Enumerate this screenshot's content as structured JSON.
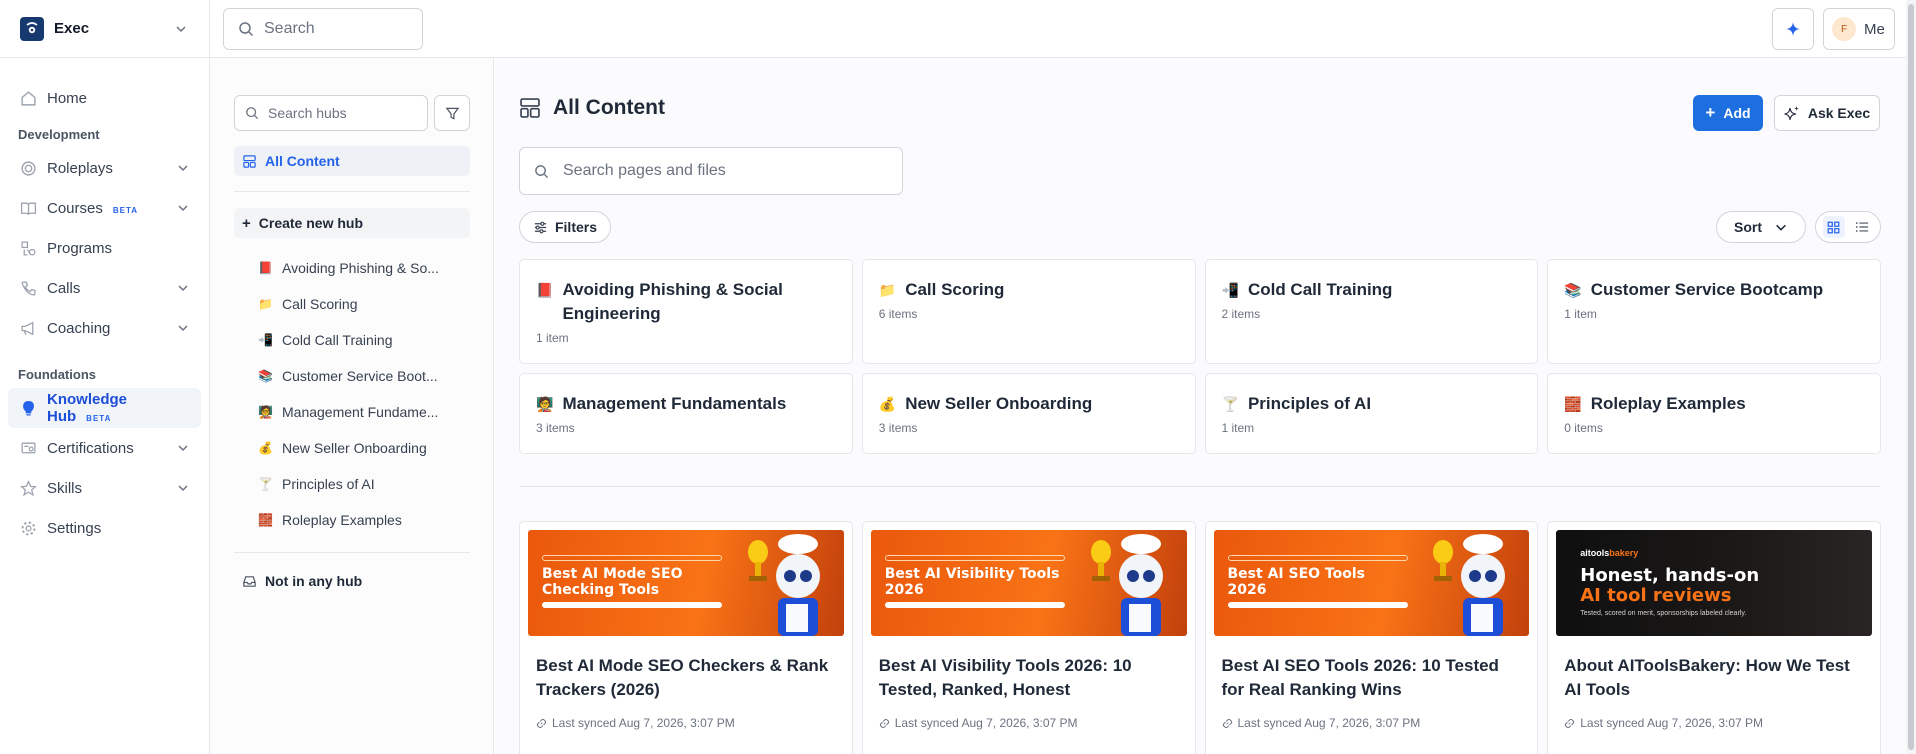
{
  "workspace": {
    "name": "Exec"
  },
  "nav": {
    "home": "Home",
    "section_development": "Development",
    "roleplays": "Roleplays",
    "courses": "Courses",
    "courses_badge": "BETA",
    "programs": "Programs",
    "calls": "Calls",
    "coaching": "Coaching",
    "section_foundations": "Foundations",
    "knowledge_hub": "Knowledge Hub",
    "knowledge_hub_badge": "BETA",
    "certifications": "Certifications",
    "skills": "Skills",
    "settings": "Settings"
  },
  "topbar": {
    "search_placeholder": "Search",
    "user_initial": "F",
    "user_label": "Me"
  },
  "hubs_pane": {
    "search_placeholder": "Search hubs",
    "all_content": "All Content",
    "create_hub": "Create new hub",
    "not_in_hub": "Not in any hub",
    "items": [
      {
        "emoji": "📕",
        "label": "Avoiding Phishing & So..."
      },
      {
        "emoji": "📁",
        "label": "Call Scoring"
      },
      {
        "emoji": "📲",
        "label": "Cold Call Training"
      },
      {
        "emoji": "📚",
        "label": "Customer Service Boot..."
      },
      {
        "emoji": "🧑‍🏫",
        "label": "Management Fundame..."
      },
      {
        "emoji": "💰",
        "label": "New Seller Onboarding"
      },
      {
        "emoji": "🍸",
        "label": "Principles of AI"
      },
      {
        "emoji": "🧱",
        "label": "Roleplay Examples"
      }
    ]
  },
  "main": {
    "title": "All Content",
    "add_label": "Add",
    "ask_label": "Ask Exec",
    "search_placeholder": "Search pages and files",
    "filters_label": "Filters",
    "sort_label": "Sort",
    "hubs": [
      {
        "emoji": "📕",
        "name": "Avoiding Phishing & Social Engineering",
        "count": "1 item"
      },
      {
        "emoji": "📁",
        "name": "Call Scoring",
        "count": "6 items"
      },
      {
        "emoji": "📲",
        "name": "Cold Call Training",
        "count": "2 items"
      },
      {
        "emoji": "📚",
        "name": "Customer Service Bootcamp",
        "count": "1 item"
      },
      {
        "emoji": "🧑‍🏫",
        "name": "Management Fundamentals",
        "count": "3 items"
      },
      {
        "emoji": "💰",
        "name": "New Seller Onboarding",
        "count": "3 items"
      },
      {
        "emoji": "🍸",
        "name": "Principles of AI",
        "count": "1 item"
      },
      {
        "emoji": "🧱",
        "name": "Roleplay Examples",
        "count": "0 items"
      }
    ],
    "pages": [
      {
        "thumb_title": "Best AI Mode SEO Checking Tools",
        "title": "Best AI Mode SEO Checkers & Rank Trackers (2026)",
        "synced": "Last synced Aug 7, 2026, 3:07 PM"
      },
      {
        "thumb_title": "Best AI Visibility Tools 2026",
        "title": "Best AI Visibility Tools 2026: 10 Tested, Ranked, Honest",
        "synced": "Last synced Aug 7, 2026, 3:07 PM"
      },
      {
        "thumb_title": "Best AI SEO Tools 2026",
        "title": "Best AI SEO Tools 2026: 10 Tested for Real Ranking Wins",
        "synced": "Last synced Aug 7, 2026, 3:07 PM"
      },
      {
        "thumb_brand_a": "aitools",
        "thumb_brand_b": "bakery",
        "thumb_h1": "Honest, hands-on",
        "thumb_h2": "AI tool reviews",
        "thumb_sub": "Tested, scored on merit, sponsorships labeled clearly.",
        "title": "About AIToolsBakery: How We Test AI Tools",
        "synced": "Last synced Aug 7, 2026, 3:07 PM"
      }
    ]
  },
  "colors": {
    "accent": "#1d6fe0",
    "active_text": "#2563eb",
    "thumb_orange": "#f97316"
  }
}
